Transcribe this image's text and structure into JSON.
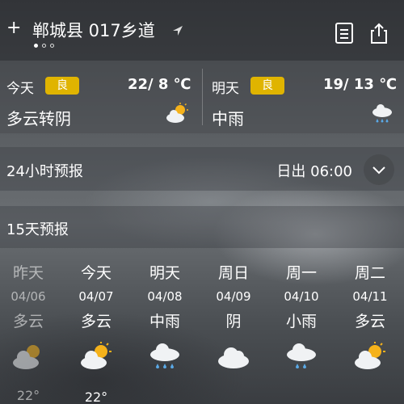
{
  "header": {
    "add_symbol": "+",
    "location": "郸城县 017乡道",
    "page_dots": 3,
    "active_dot": 0
  },
  "today": {
    "label": "今天",
    "aqi": "良",
    "temp": "22/ 8 ℃",
    "condition": "多云转阴",
    "icon": "partly-cloudy-icon"
  },
  "tomorrow": {
    "label": "明天",
    "aqi": "良",
    "temp": "19/ 13 ℃",
    "condition": "中雨",
    "icon": "rain-icon"
  },
  "hourly": {
    "title": "24小时预报",
    "sunrise": "日出 06:00"
  },
  "daily": {
    "title": "15天预报",
    "days": [
      {
        "day": "昨天",
        "date": "04/06",
        "cond": "多云",
        "icon": "partly-cloudy-icon",
        "temp": "22°"
      },
      {
        "day": "今天",
        "date": "04/07",
        "cond": "多云",
        "icon": "partly-cloudy-icon",
        "temp": "22°"
      },
      {
        "day": "明天",
        "date": "04/08",
        "cond": "中雨",
        "icon": "rain-icon",
        "temp": ""
      },
      {
        "day": "周日",
        "date": "04/09",
        "cond": "阴",
        "icon": "cloud-icon",
        "temp": ""
      },
      {
        "day": "周一",
        "date": "04/10",
        "cond": "小雨",
        "icon": "light-rain-icon",
        "temp": ""
      },
      {
        "day": "周二",
        "date": "04/11",
        "cond": "多云",
        "icon": "partly-cloudy-icon",
        "temp": ""
      }
    ]
  },
  "colors": {
    "aqi_badge": "#e0b400",
    "sun": "#f5b21b",
    "rain_drop": "#5aa9e6"
  }
}
